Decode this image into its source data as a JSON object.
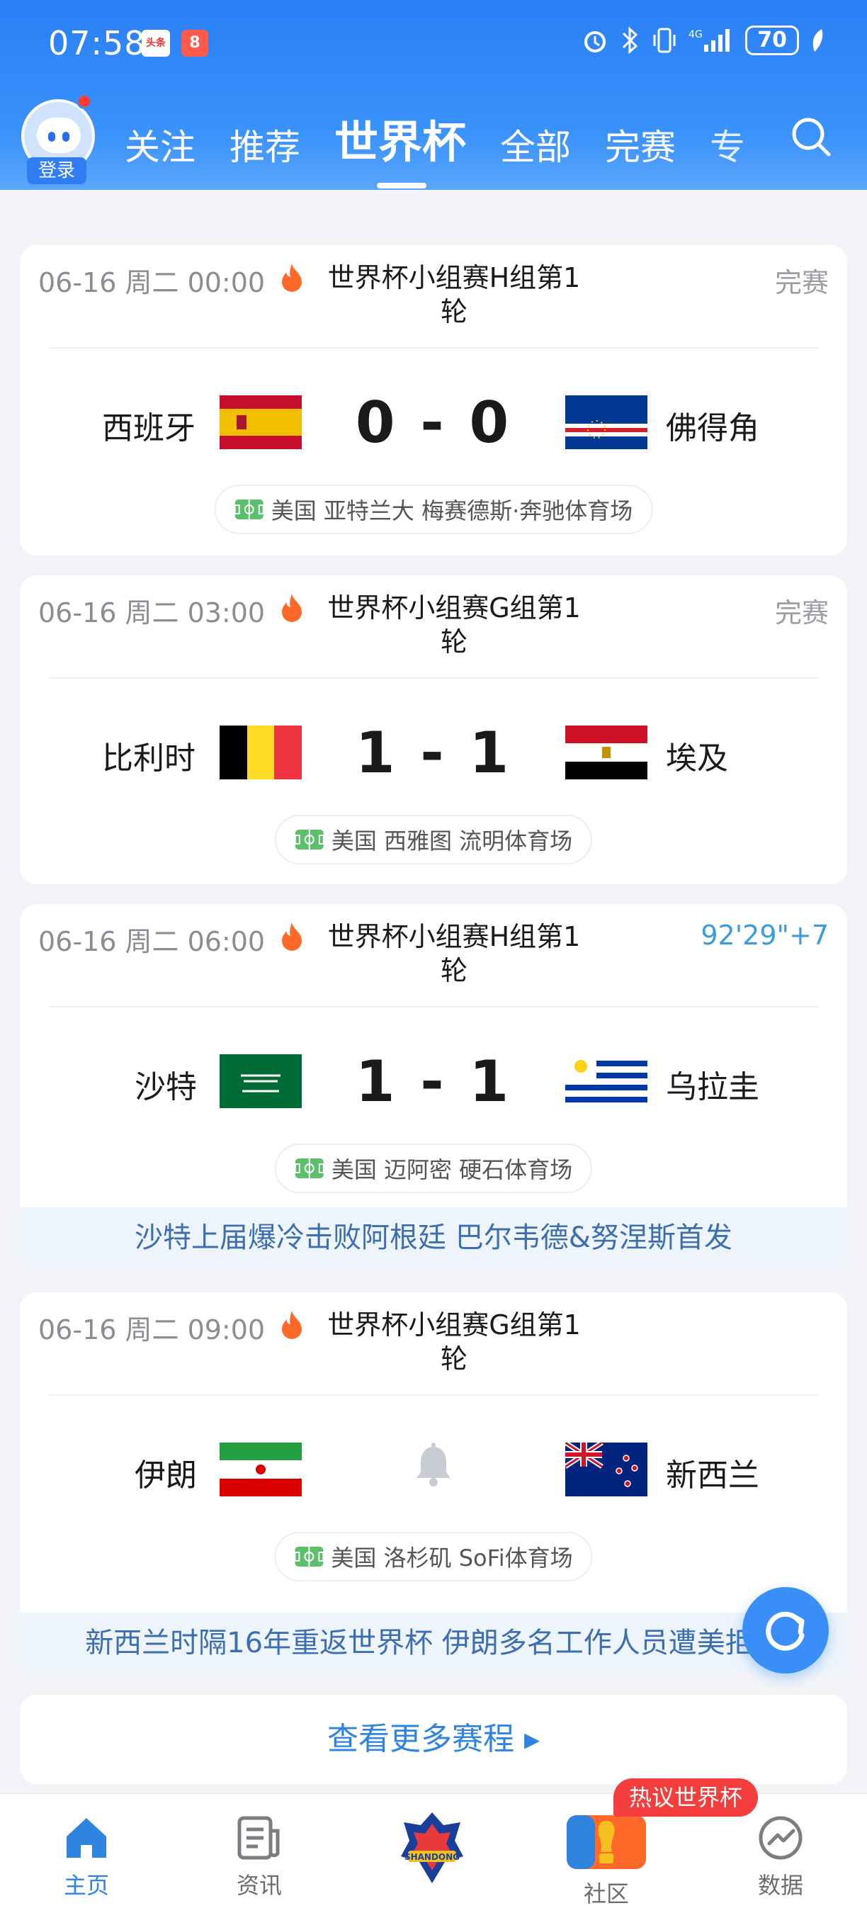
{
  "status_bar": {
    "time": "07:58",
    "app1": "头条",
    "app2": "8",
    "battery": "70"
  },
  "header": {
    "login_label": "登录",
    "tabs": [
      {
        "label": "关注"
      },
      {
        "label": "推荐"
      },
      {
        "label": "世界杯"
      },
      {
        "label": "全部"
      },
      {
        "label": "完赛"
      },
      {
        "label": "专"
      }
    ]
  },
  "matches": [
    {
      "datetime": "06-16 周二 00:00",
      "competition": "世界杯小组赛H组第1轮",
      "status": "完赛",
      "home": "西班牙",
      "away": "佛得角",
      "score": "0 - 0",
      "venue": "美国 亚特兰大 梅赛德斯·奔驰体育场"
    },
    {
      "datetime": "06-16 周二 03:00",
      "competition": "世界杯小组赛G组第1轮",
      "status": "完赛",
      "home": "比利时",
      "away": "埃及",
      "score": "1 - 1",
      "venue": "美国 西雅图 流明体育场"
    },
    {
      "datetime": "06-16 周二 06:00",
      "competition": "世界杯小组赛H组第1轮",
      "status": "92'29\"+7",
      "home": "沙特",
      "away": "乌拉圭",
      "score": "1 - 1",
      "venue": "美国 迈阿密 硬石体育场",
      "news": "沙特上届爆冷击败阿根廷 巴尔韦德&努涅斯首发"
    },
    {
      "datetime": "06-16 周二 09:00",
      "competition": "世界杯小组赛G组第1轮",
      "status": "",
      "home": "伊朗",
      "away": "新西兰",
      "score": "",
      "venue": "美国 洛杉矶 SoFi体育场",
      "news": "新西兰时隔16年重返世界杯 伊朗多名工作人员遭美拒签"
    }
  ],
  "more_label": "查看更多赛程 ▸",
  "bottom_nav": {
    "hot_badge": "热议世界杯",
    "items": [
      {
        "label": "主页"
      },
      {
        "label": "资讯"
      },
      {
        "label": "社区"
      },
      {
        "label": "数据"
      }
    ]
  },
  "colors": {
    "accent": "#2f84e0",
    "header": "#3a8ef8",
    "live": "#3a9bde"
  }
}
